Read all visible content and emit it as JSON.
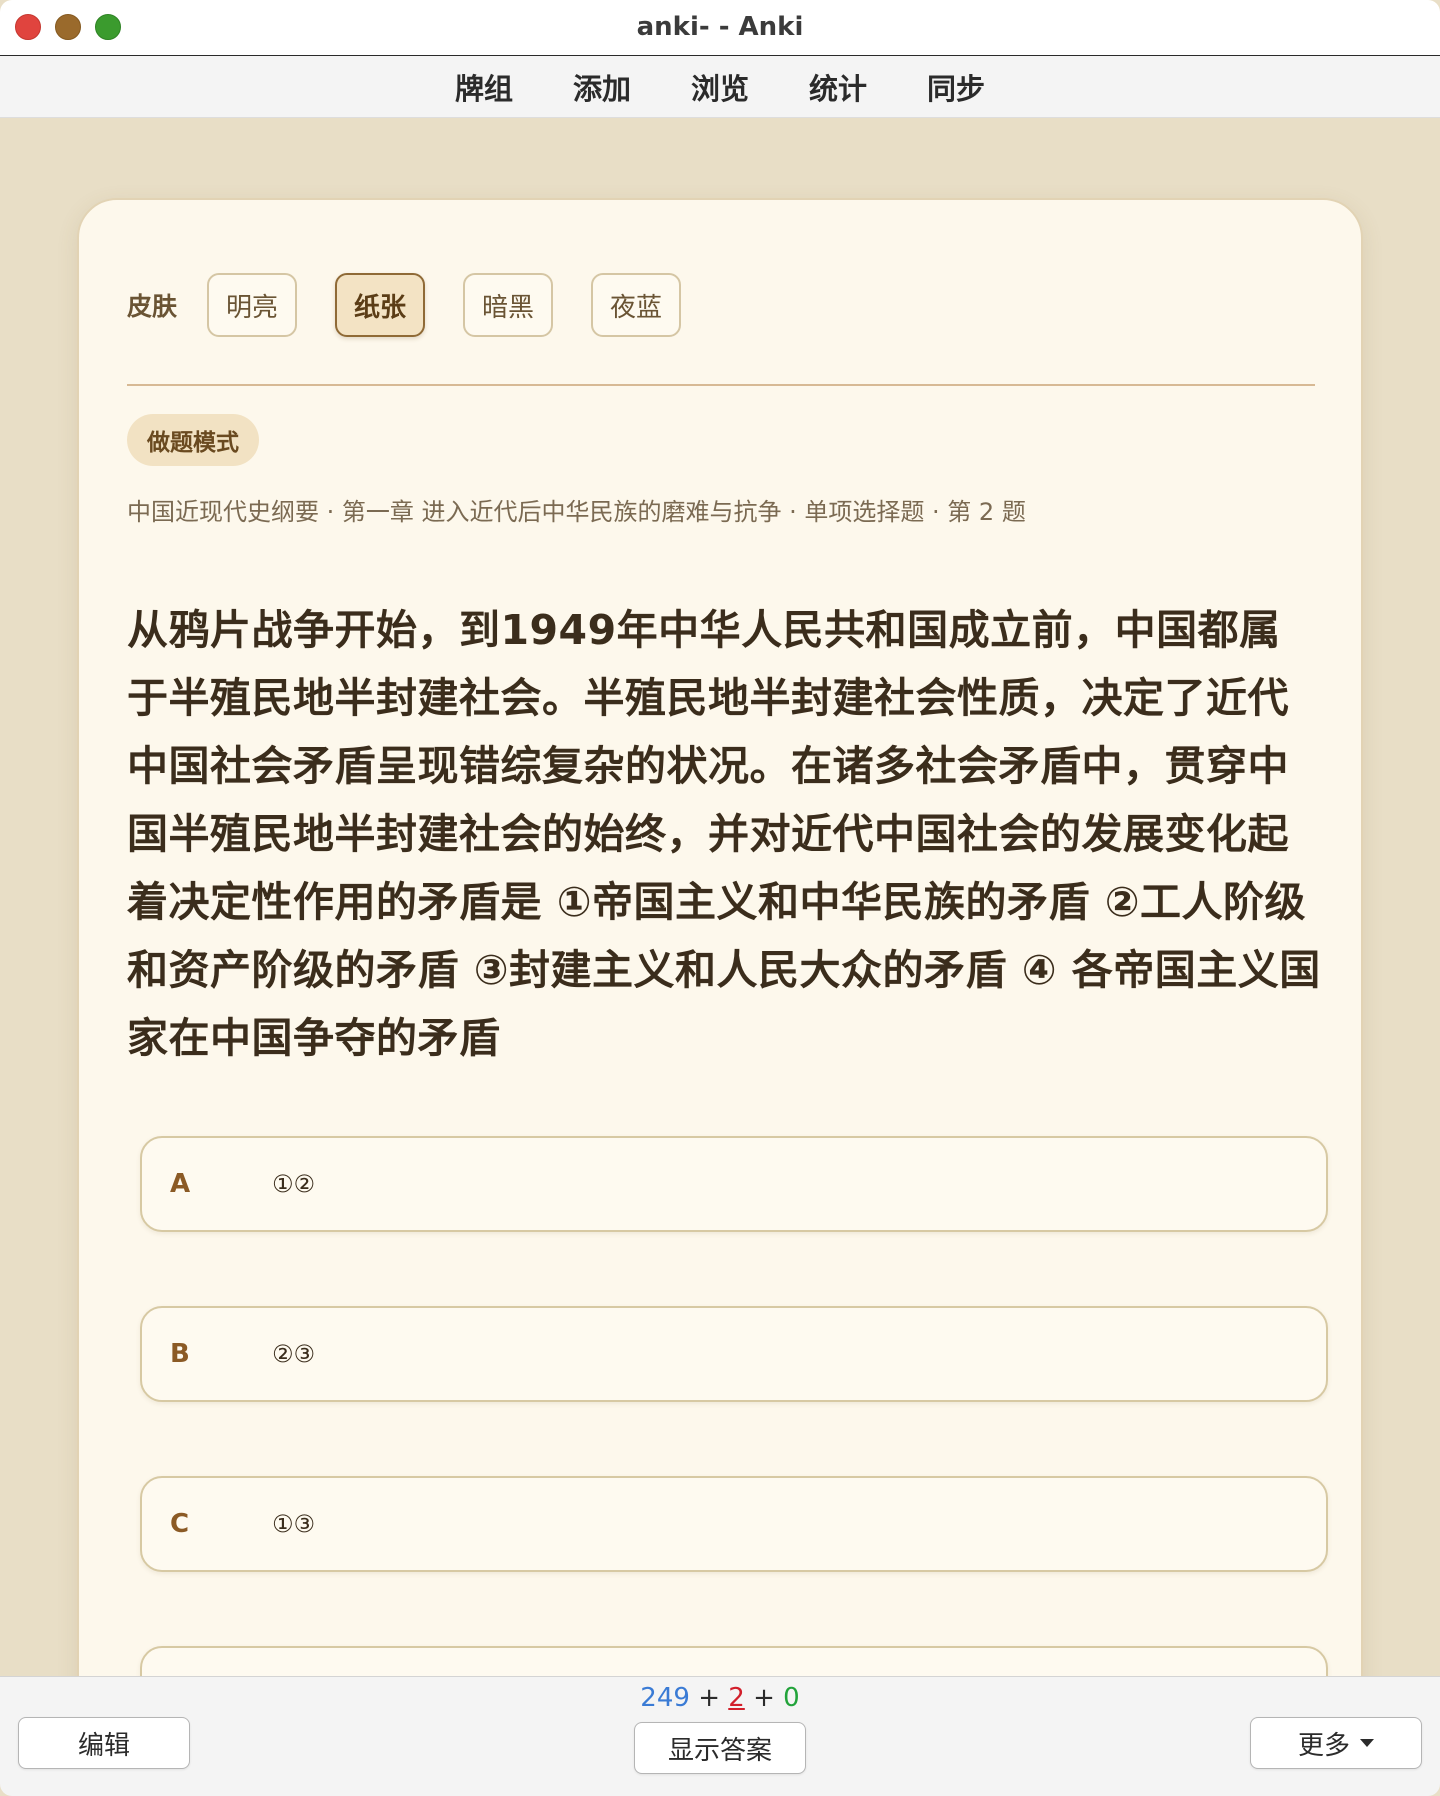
{
  "window": {
    "title": "anki- - Anki"
  },
  "nav": {
    "items": [
      "牌组",
      "添加",
      "浏览",
      "统计",
      "同步"
    ]
  },
  "skin": {
    "label": "皮肤",
    "options": [
      "明亮",
      "纸张",
      "暗黑",
      "夜蓝"
    ],
    "selected": "纸张"
  },
  "card": {
    "mode_badge": "做题模式",
    "breadcrumb": "中国近现代史纲要 · 第一章 进入近代后中华民族的磨难与抗争 · 单项选择题 · 第 2 题",
    "question": "从鸦片战争开始，到1949年中华人民共和国成立前，中国都属于半殖民地半封建社会。半殖民地半封建社会性质，决定了近代中国社会矛盾呈现错综复杂的状况。在诸多社会矛盾中，贯穿中国半殖民地半封建社会的始终，并对近代中国社会的发展变化起着决定性作用的矛盾是 ①帝国主义和中华民族的矛盾 ②工人阶级和资产阶级的矛盾 ③封建主义和人民大众的矛盾 ④ 各帝国主义国家在中国争夺的矛盾",
    "options": [
      {
        "letter": "A",
        "text": "①②"
      },
      {
        "letter": "B",
        "text": "②③"
      },
      {
        "letter": "C",
        "text": "①③"
      },
      {
        "letter": "",
        "text": ""
      }
    ]
  },
  "bottom": {
    "edit_label": "编辑",
    "show_answer_label": "显示答案",
    "more_label": "更多",
    "counts": {
      "new": "249",
      "sep1": " + ",
      "learn": "2",
      "sep2": " + ",
      "review": "0"
    }
  },
  "colors": {
    "accent_brown": "#8b5a25",
    "new_count": "#3a7bd5",
    "learn_count": "#d21f2b",
    "review_count": "#22a33a",
    "card_background": "#fdf8ec",
    "page_background": "#e8dec6"
  },
  "icons": {
    "more_dropdown": "caret-down-icon"
  }
}
